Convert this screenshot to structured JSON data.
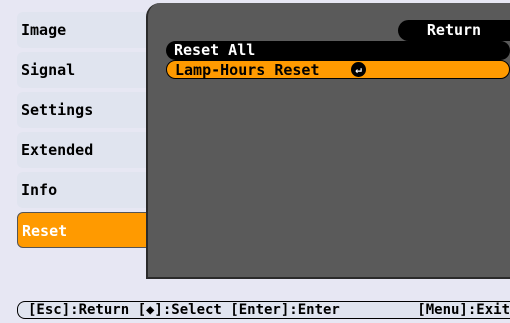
{
  "menu": {
    "items": [
      {
        "label": "Image"
      },
      {
        "label": "Signal"
      },
      {
        "label": "Settings"
      },
      {
        "label": "Extended"
      },
      {
        "label": "Info"
      },
      {
        "label": "Reset"
      }
    ],
    "active": "Reset"
  },
  "content": {
    "return_label": "Return",
    "options": [
      {
        "label": "Reset All"
      },
      {
        "label": "Lamp-Hours Reset"
      }
    ],
    "enter_icon": "enter-icon"
  },
  "status": {
    "left": "[Esc]:Return [◆]:Select [Enter]:Enter",
    "right": "[Menu]:Exit"
  },
  "colors": {
    "accent": "#ff9a00",
    "panel": "#5a5a5a",
    "background": "#e7e7f3"
  }
}
